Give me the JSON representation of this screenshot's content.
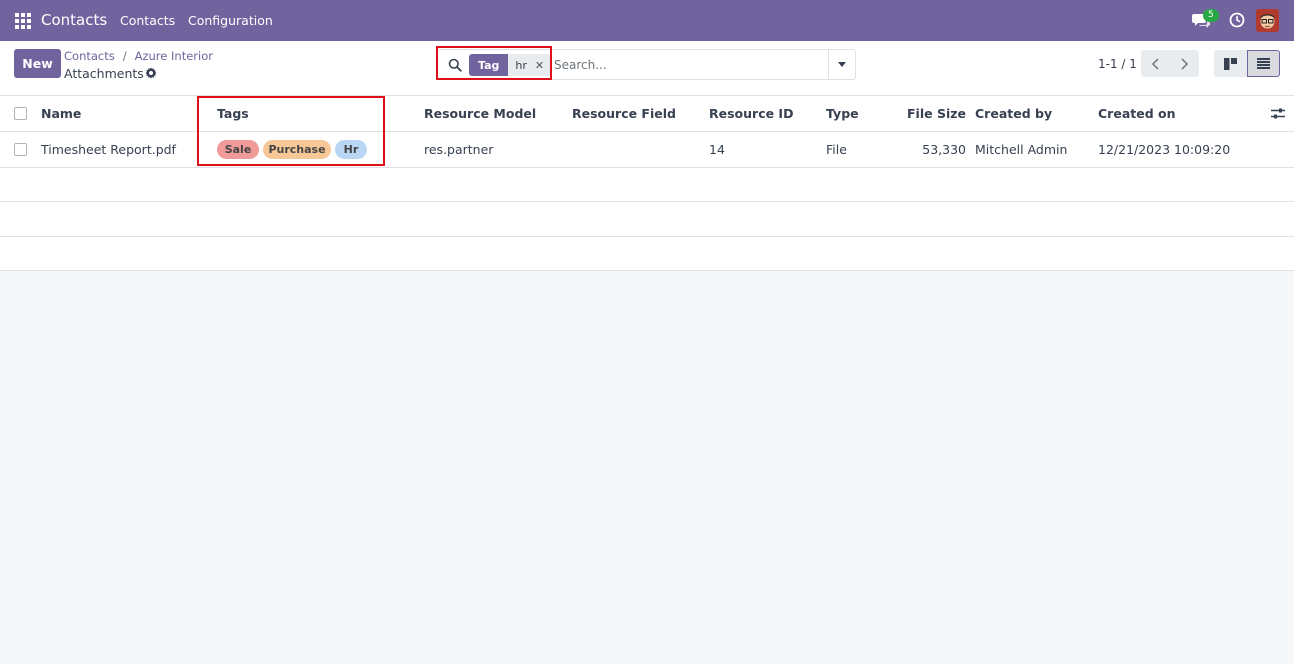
{
  "navbar": {
    "brand": "Contacts",
    "menu": [
      "Contacts",
      "Configuration"
    ],
    "chat_count": "5"
  },
  "control": {
    "new_label": "New",
    "breadcrumb": [
      "Contacts",
      "Azure Interior"
    ],
    "title": "Attachments",
    "search": {
      "facet_label": "Tag",
      "facet_value": "hr",
      "placeholder": "Search..."
    },
    "pager": "1-1 / 1"
  },
  "table": {
    "columns": [
      "Name",
      "Tags",
      "Resource Model",
      "Resource Field",
      "Resource ID",
      "Type",
      "File Size",
      "Created by",
      "Created on"
    ],
    "rows": [
      {
        "name": "Timesheet Report.pdf",
        "tags": [
          "Sale",
          "Purchase",
          "Hr"
        ],
        "resource_model": "res.partner",
        "resource_field": "",
        "resource_id": "14",
        "type": "File",
        "file_size": "53,330",
        "created_by": "Mitchell Admin",
        "created_on": "12/21/2023 10:09:20"
      }
    ]
  },
  "colors": {
    "brand": "#71639e",
    "tag_sale": "#f19a9a",
    "tag_purchase": "#f8c797",
    "tag_hr": "#b9d7f5",
    "highlight": "#e0101b"
  }
}
